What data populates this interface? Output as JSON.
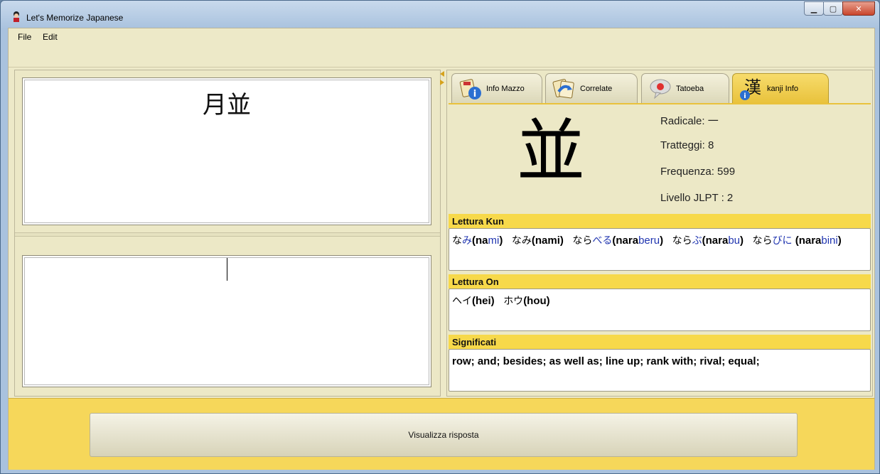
{
  "window": {
    "title": "Let's Memorize Japanese"
  },
  "menu": {
    "file": "File",
    "edit": "Edit"
  },
  "card": {
    "front": "月並"
  },
  "tabs": [
    {
      "label": "Info Mazzo"
    },
    {
      "label": "Correlate"
    },
    {
      "label": "Tatoeba"
    },
    {
      "label": "kanji Info"
    }
  ],
  "kanji": {
    "character": "並",
    "radical": "Radicale: 一",
    "strokes": "Tratteggi: 8",
    "frequency": "Frequenza: 599",
    "jlpt": "Livello JLPT : 2"
  },
  "sections": {
    "kun_title": "Lettura Kun",
    "on_title": "Lettura On",
    "meaning_title": "Significati",
    "kun": [
      {
        "kana_a": "な",
        "kana_b": "み",
        "open": "(",
        "rom_a": "na",
        "rom_b": "mi",
        "close": ")"
      },
      {
        "kana_a": "なみ",
        "kana_b": "",
        "open": "(",
        "rom_a": "nami",
        "rom_b": "",
        "close": ")"
      },
      {
        "kana_a": "なら",
        "kana_b": "べる",
        "open": "(",
        "rom_a": "nara",
        "rom_b": "beru",
        "close": ")"
      },
      {
        "kana_a": "なら",
        "kana_b": "ぶ",
        "open": "(",
        "rom_a": "nara",
        "rom_b": "bu",
        "close": ")"
      },
      {
        "kana_a": "なら",
        "kana_b": "びに",
        "open": "(",
        "rom_a": "nara",
        "rom_b": "bini",
        "close": ")"
      }
    ],
    "on": [
      {
        "kana": "ヘイ",
        "rom": "(hei)"
      },
      {
        "kana": "ホウ",
        "rom": "(hou)"
      }
    ],
    "meaning": "row; and; besides; as well as; line up; rank with; rival; equal;"
  },
  "bottom": {
    "answer_button": "Visualizza risposta"
  }
}
